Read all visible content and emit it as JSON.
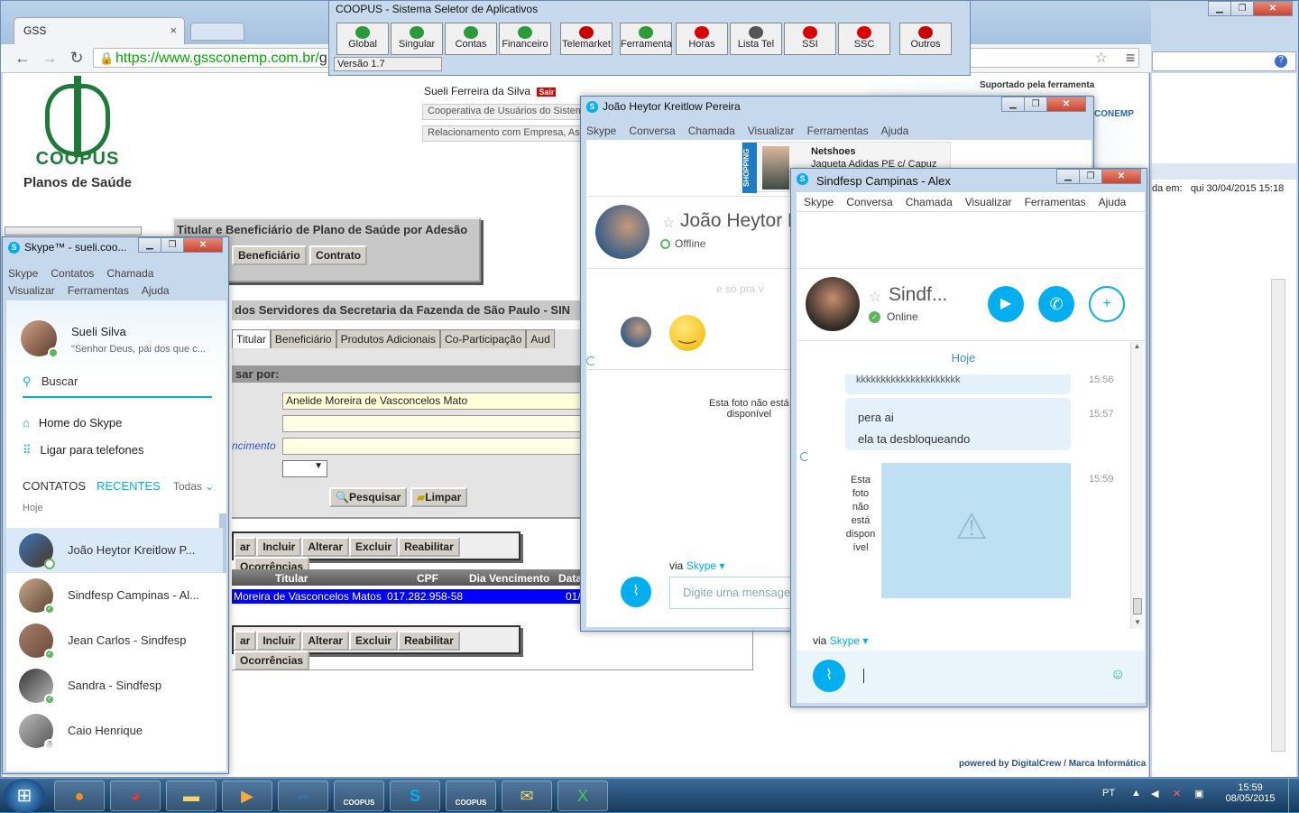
{
  "browser": {
    "tab_title": "GSS",
    "tab_close": "×",
    "url_domain": "https://www.gssconemp.com.br/",
    "url_rest": "g"
  },
  "coopus": {
    "title": "COOPUS - Sistema Seletor de Aplicativos",
    "version": "Versão 1.7",
    "apps": [
      "Global",
      "Singular",
      "Contas",
      "Financeiro",
      "Telemarket",
      "Ferramenta",
      "Horas",
      "Lista Tel",
      "SSI",
      "SSC",
      "Outros"
    ]
  },
  "page": {
    "logo_text": "COOPUS",
    "logo_subtitle": "Planos de Saúde",
    "user": "Sueli Ferreira da Silva",
    "logout": "Sair",
    "link1": "Cooperativa de Usuários do Sistem",
    "link2": "Relacionamento com Empresa, Ass",
    "supported": "Suportado pela ferramenta",
    "conemp": "CONEMP",
    "section_title": "Titular e Beneficiário de Plano de Saúde por Adesão",
    "btn_beneficiario": "Beneficiário",
    "btn_contrato": "Contrato",
    "org_title": "dos Servidores da Secretaria da Fazenda de São Paulo - SIN",
    "tabs": [
      "Titular",
      "Beneficiário",
      "Produtos Adicionais",
      "Co-Participação",
      "Aud"
    ],
    "search_by": "sar por:",
    "name_value": "Anelide Moreira de Vasconcelos Mato",
    "vencimento_label": "ncimento",
    "pesquisar": "Pesquisar",
    "limpar": "Limpar",
    "actions": [
      "ar",
      "Incluir",
      "Alterar",
      "Excluir",
      "Reabilitar",
      "Ocorrências"
    ],
    "table_headers": [
      "Titular",
      "CPF",
      "Dia Vencimento",
      "Data"
    ],
    "row": {
      "titular": "Moreira de Vasconcelos Matos",
      "cpf": "017.282.958-58",
      "data": "01/"
    },
    "footer_powered": "powered by DigitalCrew",
    "footer_sep": "/",
    "footer_marca": "Marca Informática"
  },
  "bg_right": {
    "data_em_label": "da em:",
    "data_em_value": "qui 30/04/2015 15:18"
  },
  "skype_main": {
    "title": "Skype™ - sueli.coo...",
    "menu1": [
      "Skype",
      "Contatos",
      "Chamada"
    ],
    "menu2": [
      "Visualizar",
      "Ferramentas",
      "Ajuda"
    ],
    "user_name": "Sueli Silva",
    "user_mood": "\"Senhor Deus, pai dos que c...",
    "search": "Buscar",
    "home": "Home do Skype",
    "call_phones": "Ligar para telefones",
    "tab_contacts": "CONTATOS",
    "tab_recent": "RECENTES",
    "filter": "Todas",
    "today_label": "Hoje",
    "contacts": [
      "João Heytor Kreitlow P...",
      "Sindfesp Campinas - Al...",
      "Jean Carlos - Sindfesp",
      "Sandra - Sindfesp",
      "Caio Henrique"
    ]
  },
  "skype_joao": {
    "title": "João Heytor Kreitlow Pereira",
    "menu": [
      "Skype",
      "Conversa",
      "Chamada",
      "Visualizar",
      "Ferramentas",
      "Ajuda"
    ],
    "ad_shopping": "SHOPPING",
    "ad_brand": "Netshoes",
    "ad_text": "Jaqueta Adidas PE c/ Capuz",
    "name": "João Heytor K",
    "status": "Offline",
    "faded": "e só pra v",
    "photo_na_1": "Esta foto não está",
    "photo_na_2": "disponível",
    "via": "via",
    "skype_link": "Skype",
    "input_placeholder": "Digite uma mensage"
  },
  "skype_sind": {
    "title": "Sindfesp Campinas - Alex",
    "menu": [
      "Skype",
      "Conversa",
      "Chamada",
      "Visualizar",
      "Ferramentas",
      "Ajuda"
    ],
    "name": "Sindf...",
    "status": "Online",
    "today": "Hoje",
    "msg1": "kkkkkkkkkkkkkkkkkkkkk",
    "time1": "15:56",
    "msg2a": "pera ai",
    "msg2b": "ela ta desbloqueando",
    "time2": "15:57",
    "photo_na": "Esta foto não está disponível",
    "time3": "15:59",
    "via": "via",
    "skype_link": "Skype"
  },
  "taskbar": {
    "lang": "PT",
    "time": "15:59",
    "date": "08/05/2015",
    "coopus1": "COOPUS",
    "coopus2": "COOPUS"
  },
  "colors": {
    "skype_blue": "#00aff0",
    "online": "#5cb85c",
    "row_highlight": "#0000ff"
  }
}
